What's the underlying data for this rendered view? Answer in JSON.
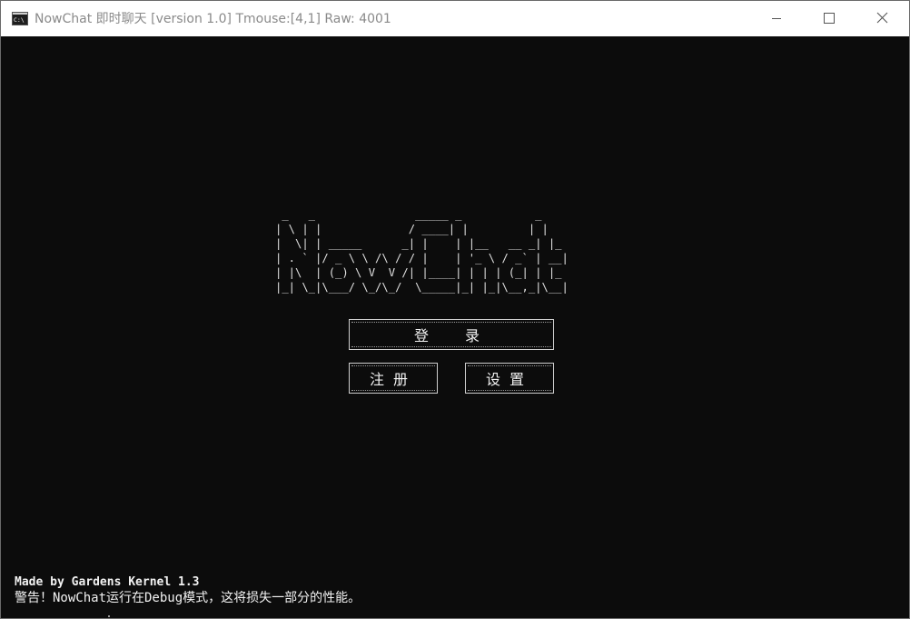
{
  "window": {
    "title": "NowChat 即时聊天 [version 1.0] Tmouse:[4,1] Raw: 4001",
    "app_icon": "console-icon",
    "controls": {
      "minimize": "minimize-icon",
      "maximize": "maximize-icon",
      "close": "close-icon"
    }
  },
  "console": {
    "logo_ascii": " _   _               _____ _           _   \n| \\ | |             / ____| |         | |  \n|  \\| | _____      _| |    | |__   __ _| |_ \n| . ` |/ _ \\ \\ /\\ / / |    | '_ \\ / _` | __|\n| |\\  | (_) \\ V  V /| |____| | | | (_| | |_ \n|_| \\_|\\___/ \\_/\\_/  \\_____|_| |_|\\__,_|\\__|",
    "buttons": {
      "login": "登录",
      "register": "注册",
      "settings": "设置"
    },
    "footer": {
      "made_by": "Made by Gardens Kernel 1.3",
      "warning": "警告！NowChat运行在Debug模式，这将损失一部分的性能。"
    }
  },
  "colors": {
    "console_bg": "#0c0c0c",
    "console_fg": "#f2f2f2",
    "titlebar_bg": "#ffffff",
    "title_text": "#8a8a8a"
  }
}
